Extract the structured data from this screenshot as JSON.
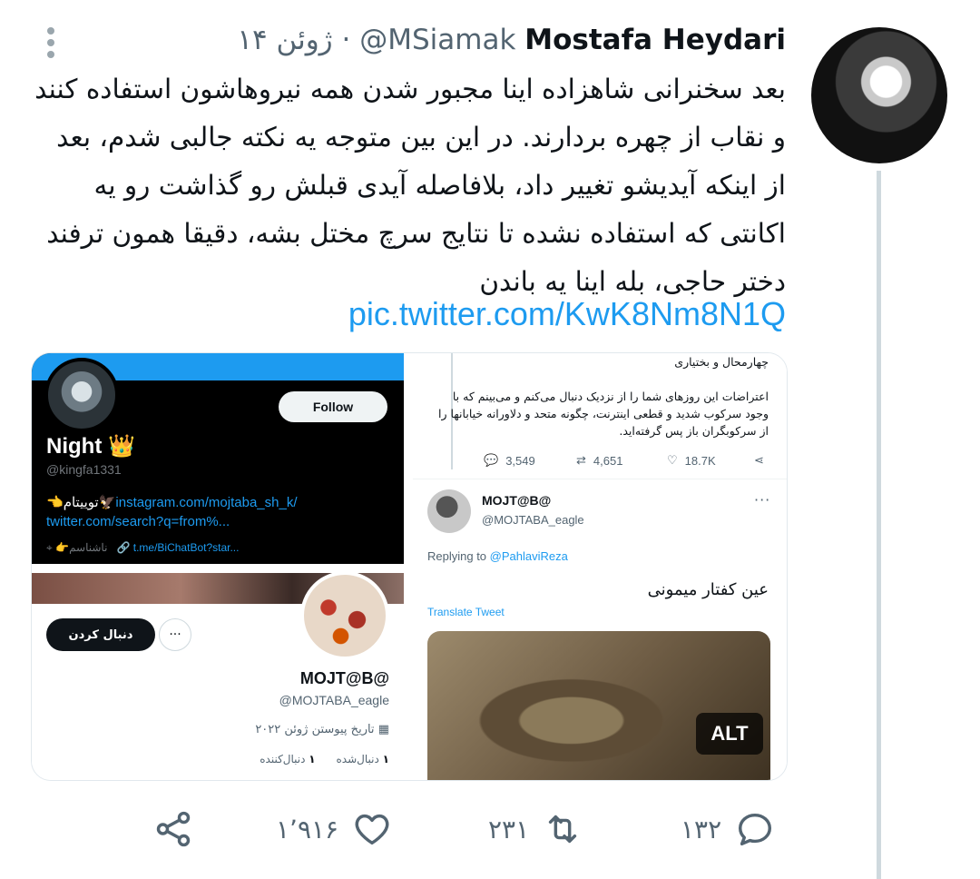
{
  "tweet": {
    "author_name": "Mostafa Heydari",
    "author_handle": "@MSiamak",
    "separator": "·",
    "date": "۱۴ ژوئن",
    "text": "بعد سخنرانی شاهزاده اینا مجبور شدن همه نیروهاشون استفاده کنند و نقاب از چهره بردارند. در این بین متوجه یه نکته جالبی شدم، بعد از اینکه آیدیشو تغییر داد، بلافاصله آیدی قبلش رو گذاشت رو یه اکانتی که استفاده نشده تا نتایج سرچ مختل بشه، دقیقا همون ترفند دختر حاجی، بله اینا یه باندن",
    "link": "pic.twitter.com/KwK8Nm8N1Q",
    "actions": {
      "replies": "۱۳۲",
      "retweets": "۲۳۱",
      "likes": "۱٬۹۱۶"
    }
  },
  "media": {
    "left_top": {
      "follow_label": "Follow",
      "name": "Night 👑",
      "handle": "@kingfa1331",
      "bio_prefix": "👈توییتام🦅",
      "bio_link1": "instagram.com/mojtaba_sh_k/",
      "bio_link2": "twitter.com/search?q=from%...",
      "location": "👉ناشناسم",
      "url": "t.me/BiChatBot?star..."
    },
    "left_bottom": {
      "follow_label": "دنبال کردن",
      "more": "···",
      "name": "MOJT@B@",
      "handle": "@MOJTABA_eagle",
      "joined": "تاریخ پیوستن ژوئن ۲۰۲۲",
      "following_count": "۱",
      "following_label": "دنبال‌شده",
      "followers_count": "۱",
      "followers_label": "دنبال‌کننده"
    },
    "right": {
      "quoted_line1": "چهارمحال و بختیاری",
      "quoted_text": "اعتراضات این روزهای شما را از نزدیک دنبال می‌کنم و می‌بینم که با وجود سرکوب شدید و قطعی اینترنت، چگونه متحد و دلاورانه خیابانها را از سرکوبگران باز پس گرفته‌اید.",
      "replies": "3,549",
      "retweets": "4,651",
      "likes": "18.7K",
      "reply_name": "MOJT@B@",
      "reply_handle": "@MOJTABA_eagle",
      "replying_prefix": "Replying to",
      "replying_to": "@PahlaviReza",
      "reply_text": "عین کفتار میمونی",
      "translate": "Translate Tweet",
      "alt": "ALT"
    }
  }
}
